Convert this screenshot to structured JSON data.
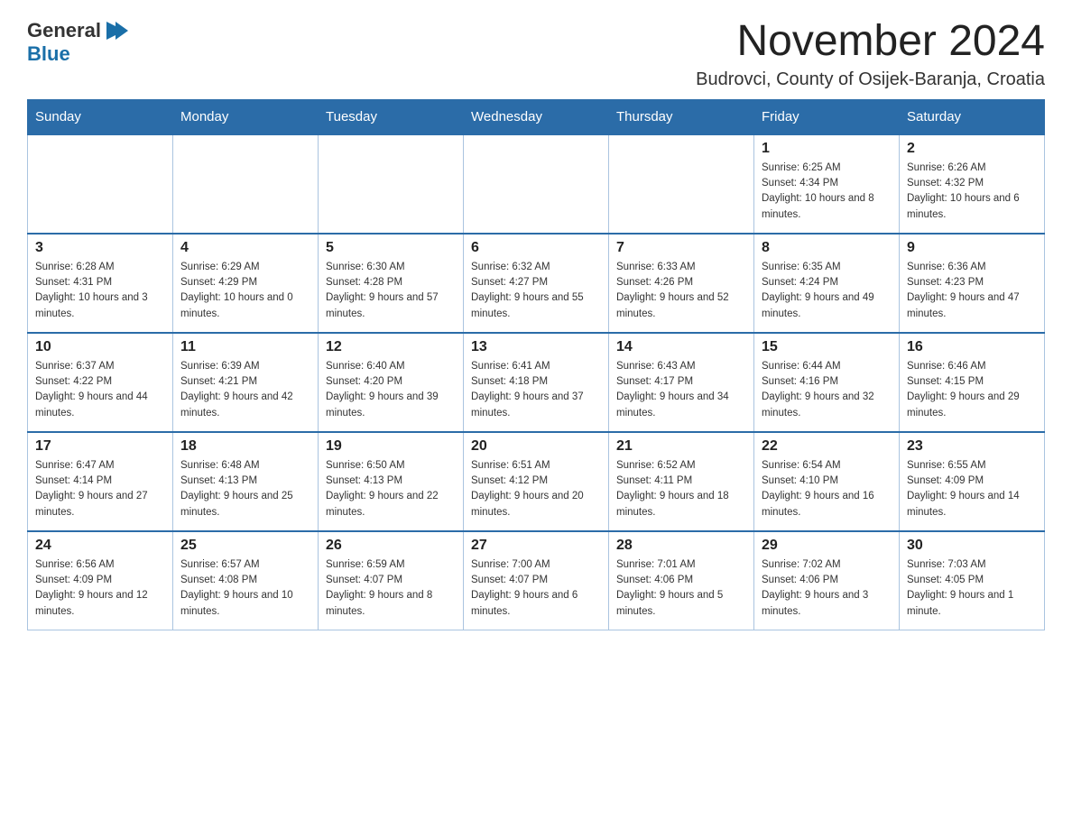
{
  "header": {
    "logo": {
      "general": "General",
      "arrow_icon": "▶",
      "blue": "Blue"
    },
    "title": "November 2024",
    "location": "Budrovci, County of Osijek-Baranja, Croatia"
  },
  "weekdays": [
    "Sunday",
    "Monday",
    "Tuesday",
    "Wednesday",
    "Thursday",
    "Friday",
    "Saturday"
  ],
  "weeks": [
    [
      {
        "day": "",
        "info": ""
      },
      {
        "day": "",
        "info": ""
      },
      {
        "day": "",
        "info": ""
      },
      {
        "day": "",
        "info": ""
      },
      {
        "day": "",
        "info": ""
      },
      {
        "day": "1",
        "info": "Sunrise: 6:25 AM\nSunset: 4:34 PM\nDaylight: 10 hours and 8 minutes."
      },
      {
        "day": "2",
        "info": "Sunrise: 6:26 AM\nSunset: 4:32 PM\nDaylight: 10 hours and 6 minutes."
      }
    ],
    [
      {
        "day": "3",
        "info": "Sunrise: 6:28 AM\nSunset: 4:31 PM\nDaylight: 10 hours and 3 minutes."
      },
      {
        "day": "4",
        "info": "Sunrise: 6:29 AM\nSunset: 4:29 PM\nDaylight: 10 hours and 0 minutes."
      },
      {
        "day": "5",
        "info": "Sunrise: 6:30 AM\nSunset: 4:28 PM\nDaylight: 9 hours and 57 minutes."
      },
      {
        "day": "6",
        "info": "Sunrise: 6:32 AM\nSunset: 4:27 PM\nDaylight: 9 hours and 55 minutes."
      },
      {
        "day": "7",
        "info": "Sunrise: 6:33 AM\nSunset: 4:26 PM\nDaylight: 9 hours and 52 minutes."
      },
      {
        "day": "8",
        "info": "Sunrise: 6:35 AM\nSunset: 4:24 PM\nDaylight: 9 hours and 49 minutes."
      },
      {
        "day": "9",
        "info": "Sunrise: 6:36 AM\nSunset: 4:23 PM\nDaylight: 9 hours and 47 minutes."
      }
    ],
    [
      {
        "day": "10",
        "info": "Sunrise: 6:37 AM\nSunset: 4:22 PM\nDaylight: 9 hours and 44 minutes."
      },
      {
        "day": "11",
        "info": "Sunrise: 6:39 AM\nSunset: 4:21 PM\nDaylight: 9 hours and 42 minutes."
      },
      {
        "day": "12",
        "info": "Sunrise: 6:40 AM\nSunset: 4:20 PM\nDaylight: 9 hours and 39 minutes."
      },
      {
        "day": "13",
        "info": "Sunrise: 6:41 AM\nSunset: 4:18 PM\nDaylight: 9 hours and 37 minutes."
      },
      {
        "day": "14",
        "info": "Sunrise: 6:43 AM\nSunset: 4:17 PM\nDaylight: 9 hours and 34 minutes."
      },
      {
        "day": "15",
        "info": "Sunrise: 6:44 AM\nSunset: 4:16 PM\nDaylight: 9 hours and 32 minutes."
      },
      {
        "day": "16",
        "info": "Sunrise: 6:46 AM\nSunset: 4:15 PM\nDaylight: 9 hours and 29 minutes."
      }
    ],
    [
      {
        "day": "17",
        "info": "Sunrise: 6:47 AM\nSunset: 4:14 PM\nDaylight: 9 hours and 27 minutes."
      },
      {
        "day": "18",
        "info": "Sunrise: 6:48 AM\nSunset: 4:13 PM\nDaylight: 9 hours and 25 minutes."
      },
      {
        "day": "19",
        "info": "Sunrise: 6:50 AM\nSunset: 4:13 PM\nDaylight: 9 hours and 22 minutes."
      },
      {
        "day": "20",
        "info": "Sunrise: 6:51 AM\nSunset: 4:12 PM\nDaylight: 9 hours and 20 minutes."
      },
      {
        "day": "21",
        "info": "Sunrise: 6:52 AM\nSunset: 4:11 PM\nDaylight: 9 hours and 18 minutes."
      },
      {
        "day": "22",
        "info": "Sunrise: 6:54 AM\nSunset: 4:10 PM\nDaylight: 9 hours and 16 minutes."
      },
      {
        "day": "23",
        "info": "Sunrise: 6:55 AM\nSunset: 4:09 PM\nDaylight: 9 hours and 14 minutes."
      }
    ],
    [
      {
        "day": "24",
        "info": "Sunrise: 6:56 AM\nSunset: 4:09 PM\nDaylight: 9 hours and 12 minutes."
      },
      {
        "day": "25",
        "info": "Sunrise: 6:57 AM\nSunset: 4:08 PM\nDaylight: 9 hours and 10 minutes."
      },
      {
        "day": "26",
        "info": "Sunrise: 6:59 AM\nSunset: 4:07 PM\nDaylight: 9 hours and 8 minutes."
      },
      {
        "day": "27",
        "info": "Sunrise: 7:00 AM\nSunset: 4:07 PM\nDaylight: 9 hours and 6 minutes."
      },
      {
        "day": "28",
        "info": "Sunrise: 7:01 AM\nSunset: 4:06 PM\nDaylight: 9 hours and 5 minutes."
      },
      {
        "day": "29",
        "info": "Sunrise: 7:02 AM\nSunset: 4:06 PM\nDaylight: 9 hours and 3 minutes."
      },
      {
        "day": "30",
        "info": "Sunrise: 7:03 AM\nSunset: 4:05 PM\nDaylight: 9 hours and 1 minute."
      }
    ]
  ]
}
